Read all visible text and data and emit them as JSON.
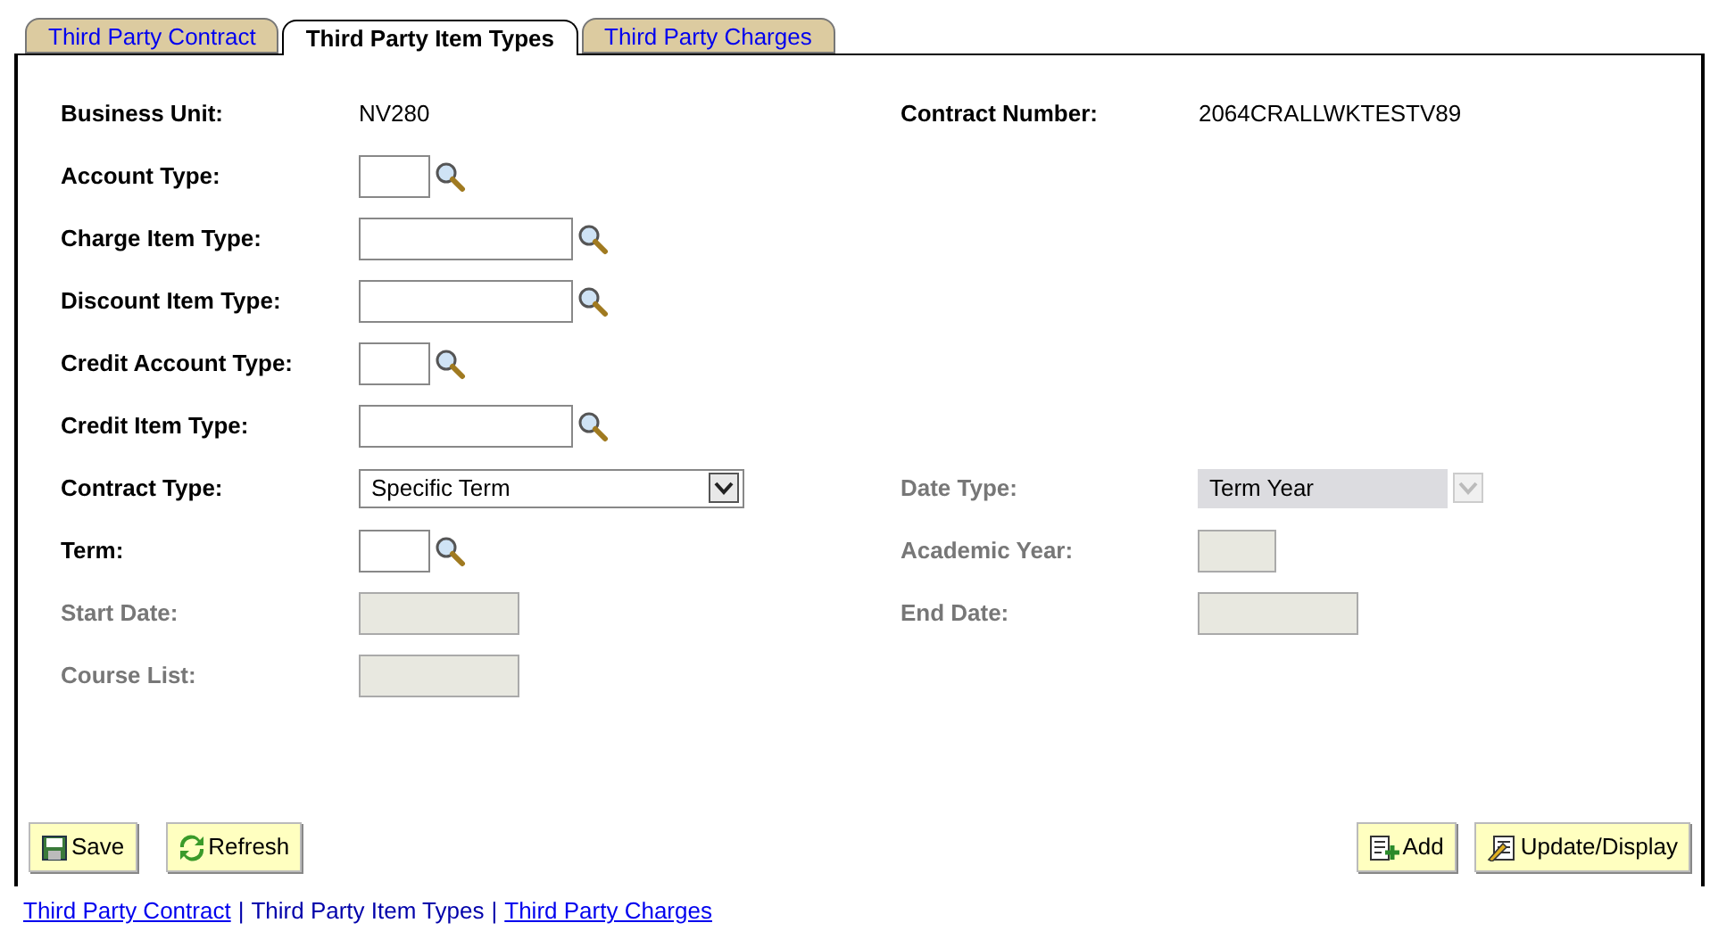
{
  "tabs": [
    {
      "label": "Third Party Contract",
      "selected": false
    },
    {
      "label": "Third Party Item Types",
      "selected": true
    },
    {
      "label": "Third Party Charges",
      "selected": false
    }
  ],
  "rows": [
    {
      "left": {
        "label": "Business Unit:",
        "kind": "display",
        "value": "NV280",
        "disabled": false
      },
      "right": {
        "label": "Contract Number:",
        "kind": "display",
        "value": "2064CRALLWKTESTV89",
        "disabled": false
      }
    },
    {
      "left": {
        "label": "Account Type:",
        "kind": "short_lookup",
        "disabled": false
      }
    },
    {
      "left": {
        "label": "Charge Item Type:",
        "kind": "long_lookup",
        "disabled": false
      }
    },
    {
      "left": {
        "label": "Discount Item Type:",
        "kind": "long_lookup",
        "disabled": false
      }
    },
    {
      "left": {
        "label": "Credit Account Type:",
        "kind": "short_lookup",
        "disabled": false
      }
    },
    {
      "left": {
        "label": "Credit Item Type:",
        "kind": "long_lookup",
        "disabled": false
      }
    },
    {
      "left": {
        "label": "Contract Type:",
        "kind": "select",
        "value": "Specific Term",
        "disabled": false
      },
      "right": {
        "label": "Date Type:",
        "kind": "select",
        "value": "Term Year",
        "disabled": true
      }
    },
    {
      "left": {
        "label": "Term:",
        "kind": "short_lookup",
        "disabled": false
      },
      "right": {
        "label": "Academic Year:",
        "kind": "short_input",
        "disabled": true
      }
    },
    {
      "left": {
        "label": "Start Date:",
        "kind": "input",
        "disabled": true
      },
      "right": {
        "label": "End Date:",
        "kind": "input",
        "disabled": true
      }
    },
    {
      "left": {
        "label": "Course List:",
        "kind": "input",
        "disabled": true
      }
    }
  ],
  "left_buttons": [
    {
      "label": "Save",
      "kind": "save"
    },
    {
      "label": "Refresh",
      "kind": "refresh"
    }
  ],
  "right_buttons": [
    {
      "label": "Add",
      "kind": "add"
    },
    {
      "label": "Update/Display",
      "kind": "update"
    }
  ],
  "links": [
    {
      "label": "Third Party Contract",
      "linked": true
    },
    {
      "label": "Third Party Item Types",
      "linked": false
    },
    {
      "label": "Third Party Charges",
      "linked": true
    }
  ],
  "link_separator": "|"
}
